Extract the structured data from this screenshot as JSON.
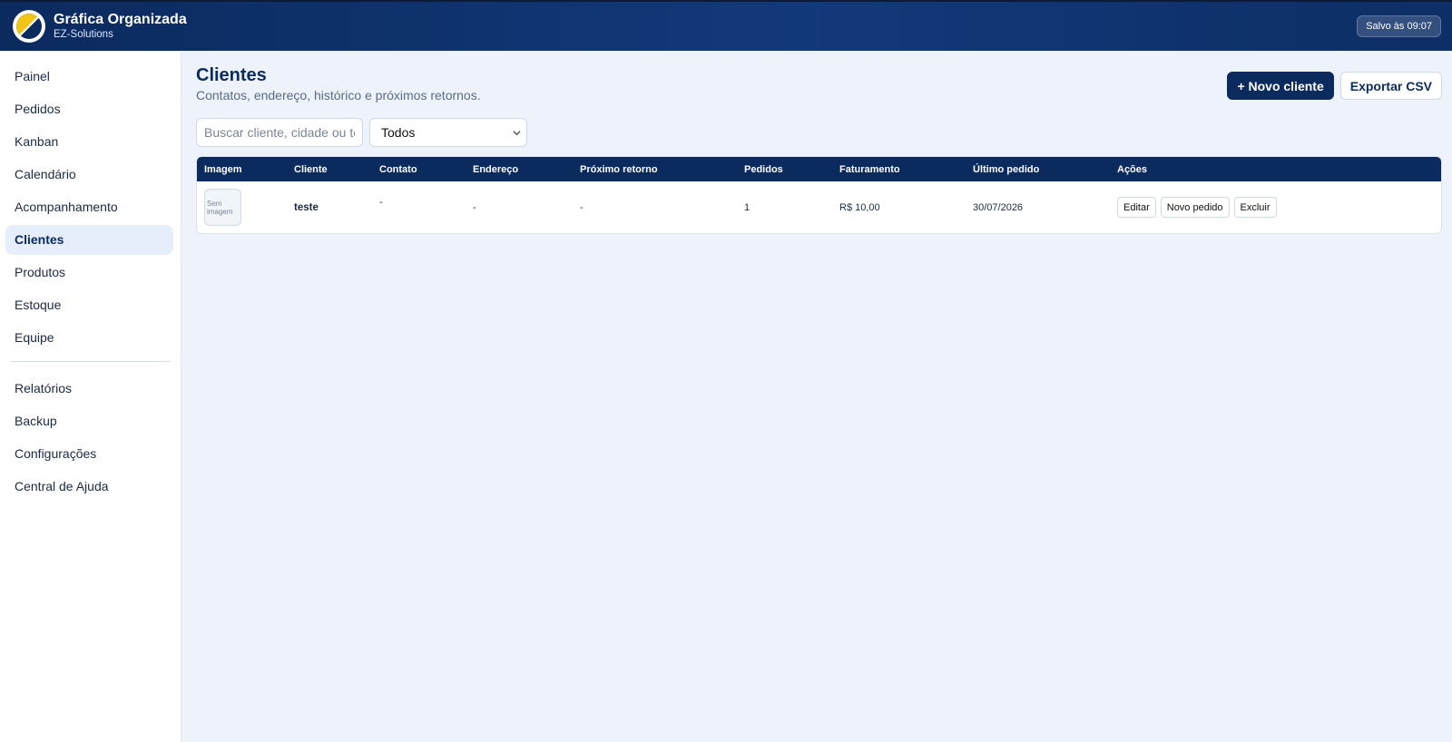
{
  "header": {
    "app_title": "Gráfica Organizada",
    "app_subtitle": "EZ-Solutions",
    "saved_status": "Salvo às 09:07",
    "logo_icon": "half-moon-logo-icon"
  },
  "sidebar": {
    "primary_items": [
      {
        "label": "Painel",
        "active": false
      },
      {
        "label": "Pedidos",
        "active": false
      },
      {
        "label": "Kanban",
        "active": false
      },
      {
        "label": "Calendário",
        "active": false
      },
      {
        "label": "Acompanhamento",
        "active": false
      },
      {
        "label": "Clientes",
        "active": true
      },
      {
        "label": "Produtos",
        "active": false
      },
      {
        "label": "Estoque",
        "active": false
      },
      {
        "label": "Equipe",
        "active": false
      }
    ],
    "secondary_items": [
      {
        "label": "Relatórios"
      },
      {
        "label": "Backup"
      },
      {
        "label": "Configurações"
      },
      {
        "label": "Central de Ajuda"
      }
    ]
  },
  "page": {
    "title": "Clientes",
    "subtitle": "Contatos, endereço, histórico e próximos retornos."
  },
  "toolbar": {
    "new_client_label": "+ Novo cliente",
    "export_label": "Exportar CSV"
  },
  "filters": {
    "search_placeholder": "Buscar cliente, cidade ou telefone",
    "status_selected": "Todos"
  },
  "table": {
    "columns": [
      "Imagem",
      "Cliente",
      "Contato",
      "Endereço",
      "Próximo retorno",
      "Pedidos",
      "Faturamento",
      "Último pedido",
      "Ações"
    ],
    "rows": [
      {
        "image_placeholder": "Sem imagem",
        "cliente": "teste",
        "contato": "-",
        "endereco": "-",
        "proximo_retorno": "-",
        "pedidos": "1",
        "faturamento": "R$ 10,00",
        "ultimo_pedido": "30/07/2026",
        "actions": {
          "edit": "Editar",
          "new_order": "Novo pedido",
          "delete": "Excluir"
        }
      }
    ]
  },
  "colors": {
    "primary": "#0b2a5e",
    "background": "#eef3fb",
    "active_nav_bg": "#e6eefb",
    "logo_yellow": "#f2c418"
  }
}
